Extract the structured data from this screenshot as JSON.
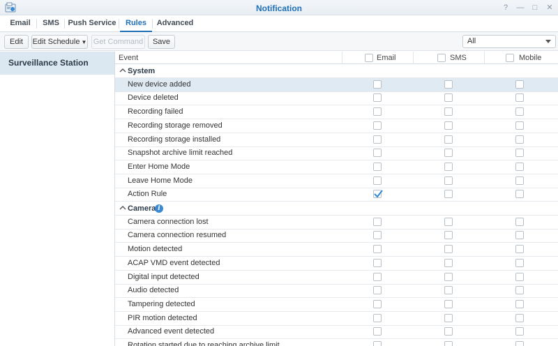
{
  "window": {
    "title": "Notification",
    "controls": [
      "?",
      "—",
      "□",
      "✕"
    ]
  },
  "tabs": [
    {
      "label": "Email",
      "active": false
    },
    {
      "label": "SMS",
      "active": false
    },
    {
      "label": "Push Service",
      "active": false
    },
    {
      "label": "Rules",
      "active": true
    },
    {
      "label": "Advanced",
      "active": false
    }
  ],
  "toolbar": {
    "edit": "Edit",
    "edit_schedule": "Edit Schedule",
    "get_command": "Get Command",
    "save": "Save",
    "filter_value": "All"
  },
  "sidebar": {
    "items": [
      {
        "label": "Surveillance Station",
        "selected": true
      }
    ]
  },
  "table": {
    "headers": {
      "event": "Event",
      "email": "Email",
      "sms": "SMS",
      "mobile": "Mobile"
    },
    "groups": [
      {
        "name": "System",
        "info": false,
        "rows": [
          {
            "event": "New device added",
            "email": false,
            "sms": false,
            "mobile": false,
            "selected": true
          },
          {
            "event": "Device deleted",
            "email": false,
            "sms": false,
            "mobile": false
          },
          {
            "event": "Recording failed",
            "email": false,
            "sms": false,
            "mobile": false
          },
          {
            "event": "Recording storage removed",
            "email": false,
            "sms": false,
            "mobile": false
          },
          {
            "event": "Recording storage installed",
            "email": false,
            "sms": false,
            "mobile": false
          },
          {
            "event": "Snapshot archive limit reached",
            "email": false,
            "sms": false,
            "mobile": false
          },
          {
            "event": "Enter Home Mode",
            "email": false,
            "sms": false,
            "mobile": false
          },
          {
            "event": "Leave Home Mode",
            "email": false,
            "sms": false,
            "mobile": false
          },
          {
            "event": "Action Rule",
            "email": true,
            "sms": false,
            "mobile": false
          }
        ]
      },
      {
        "name": "Camera",
        "info": true,
        "rows": [
          {
            "event": "Camera connection lost",
            "email": false,
            "sms": false,
            "mobile": false
          },
          {
            "event": "Camera connection resumed",
            "email": false,
            "sms": false,
            "mobile": false
          },
          {
            "event": "Motion detected",
            "email": false,
            "sms": false,
            "mobile": false
          },
          {
            "event": "ACAP VMD event detected",
            "email": false,
            "sms": false,
            "mobile": false
          },
          {
            "event": "Digital input detected",
            "email": false,
            "sms": false,
            "mobile": false
          },
          {
            "event": "Audio detected",
            "email": false,
            "sms": false,
            "mobile": false
          },
          {
            "event": "Tampering detected",
            "email": false,
            "sms": false,
            "mobile": false
          },
          {
            "event": "PIR motion detected",
            "email": false,
            "sms": false,
            "mobile": false
          },
          {
            "event": "Advanced event detected",
            "email": false,
            "sms": false,
            "mobile": false
          },
          {
            "event": "Rotation started due to reaching archive limit",
            "email": false,
            "sms": false,
            "mobile": false
          }
        ]
      }
    ]
  },
  "colors": {
    "accent": "#1f6fb6",
    "check": "#2f86d6",
    "selected_row": "#dfeaf3",
    "info": "#3a8ad3"
  },
  "icons": {
    "app": "notification-app-icon",
    "collapse": "chevron-up-icon",
    "info": "info-icon",
    "check": "checkmark-icon"
  }
}
